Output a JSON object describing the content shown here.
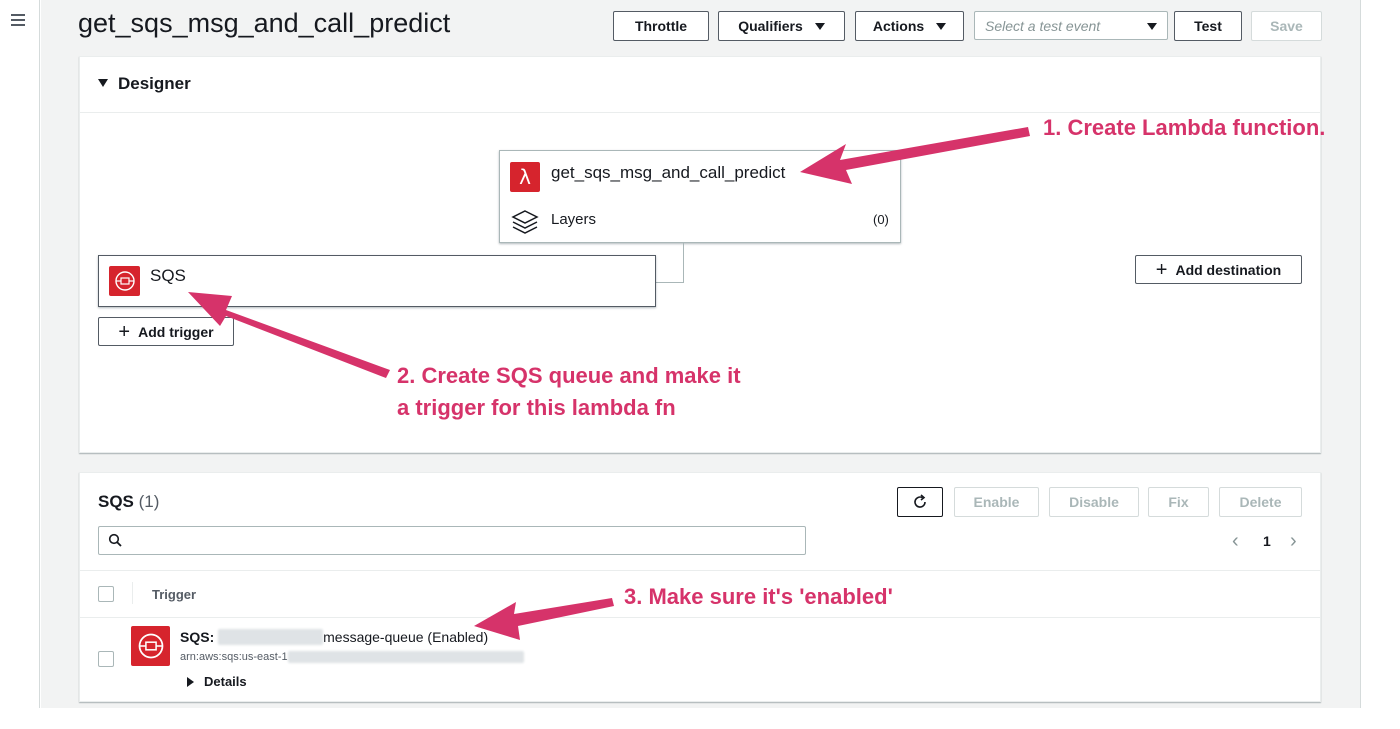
{
  "page": {
    "title": "get_sqs_msg_and_call_predict"
  },
  "toolbar": {
    "throttle": "Throttle",
    "qualifiers": "Qualifiers",
    "actions": "Actions",
    "test_event_placeholder": "Select a test event",
    "test": "Test",
    "save": "Save"
  },
  "designer": {
    "title": "Designer",
    "function_name": "get_sqs_msg_and_call_predict",
    "layers_label": "Layers",
    "layers_count": "(0)",
    "trigger_label": "SQS",
    "add_trigger": "Add trigger",
    "add_destination": "Add destination"
  },
  "annotations": {
    "step1": "1. Create Lambda function.",
    "step2_line1": "2. Create SQS queue and make it",
    "step2_line2": "a trigger for this lambda fn",
    "step3": "3. Make sure it's 'enabled'",
    "color": "#d6336a"
  },
  "sqs_panel": {
    "title": "SQS",
    "count": "(1)",
    "buttons": {
      "enable": "Enable",
      "disable": "Disable",
      "fix": "Fix",
      "delete": "Delete"
    },
    "pagination": {
      "page": "1"
    },
    "columns": {
      "trigger": "Trigger"
    },
    "row": {
      "prefix": "SQS:",
      "queue_suffix": "message-queue",
      "status": "(Enabled)",
      "arn_prefix": "arn:aws:sqs:us-east-1",
      "details": "Details"
    }
  },
  "icons": {
    "menu": "menu-icon",
    "lambda": "lambda-icon",
    "layers": "layers-icon",
    "sqs": "sqs-icon",
    "refresh": "refresh-icon",
    "search": "search-icon"
  },
  "colors": {
    "brand_red": "#d6242d",
    "text": "#16191f"
  }
}
